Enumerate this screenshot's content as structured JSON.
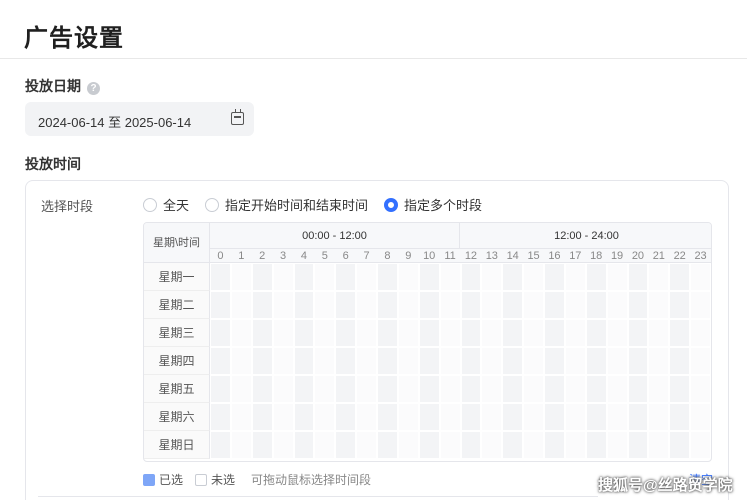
{
  "page": {
    "title": "广告设置"
  },
  "date_section": {
    "label": "投放日期",
    "help_icon": "question-icon",
    "range_text": "2024-06-14 至 2025-06-14",
    "calendar_icon": "calendar-icon"
  },
  "time_section": {
    "label": "投放时间",
    "field_label": "选择时段",
    "radio_options": [
      {
        "label": "全天",
        "checked": false
      },
      {
        "label": "指定开始时间和结束时间",
        "checked": false
      },
      {
        "label": "指定多个时段",
        "checked": true
      }
    ],
    "grid": {
      "corner_label": "星期\\时间",
      "half_labels": [
        "00:00 - 12:00",
        "12:00 - 24:00"
      ],
      "hours": [
        "0",
        "1",
        "2",
        "3",
        "4",
        "5",
        "6",
        "7",
        "8",
        "9",
        "10",
        "11",
        "12",
        "13",
        "14",
        "15",
        "16",
        "17",
        "18",
        "19",
        "20",
        "21",
        "22",
        "23"
      ],
      "days": [
        "星期一",
        "星期二",
        "星期三",
        "星期四",
        "星期五",
        "星期六",
        "星期日"
      ]
    },
    "legend": {
      "selected_label": "已选",
      "unselected_label": "未选",
      "hint": "可拖动鼠标选择时间段"
    },
    "clear_label": "清空"
  },
  "watermark": "搜狐号@丝路贸学院",
  "colors": {
    "accent": "#3370ff",
    "selected": "#7ea6f7"
  }
}
